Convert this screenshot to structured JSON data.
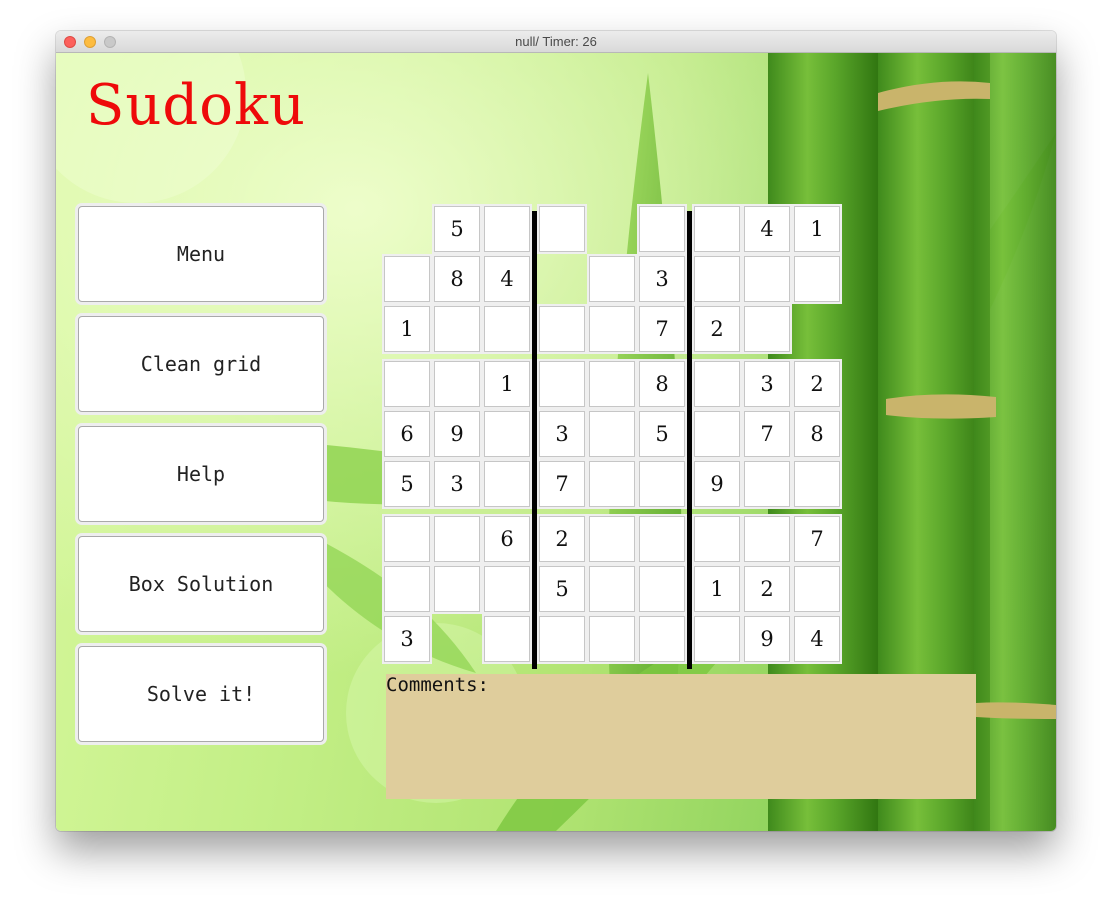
{
  "window": {
    "title": "null/ Timer: 26"
  },
  "app": {
    "title": "Sudoku"
  },
  "buttons": [
    {
      "id": "menu",
      "label": "Menu"
    },
    {
      "id": "clean-grid",
      "label": "Clean grid"
    },
    {
      "id": "help",
      "label": "Help"
    },
    {
      "id": "box-solution",
      "label": "Box Solution"
    },
    {
      "id": "solve",
      "label": "Solve it!"
    }
  ],
  "grid": {
    "rows": [
      [
        "",
        "5",
        "",
        "",
        "",
        "",
        "",
        "4",
        "1"
      ],
      [
        "",
        "8",
        "4",
        "",
        "",
        "3",
        "",
        "",
        ""
      ],
      [
        "1",
        "",
        "",
        "",
        "",
        "7",
        "2",
        "",
        ""
      ],
      [
        "",
        "",
        "1",
        "",
        "",
        "8",
        "",
        "3",
        "2"
      ],
      [
        "6",
        "9",
        "",
        "3",
        "",
        "5",
        "",
        "7",
        "8"
      ],
      [
        "5",
        "3",
        "",
        "7",
        "",
        "",
        "9",
        "",
        ""
      ],
      [
        "",
        "",
        "6",
        "2",
        "",
        "",
        "",
        "",
        "7"
      ],
      [
        "",
        "",
        "",
        "5",
        "",
        "",
        "1",
        "2",
        ""
      ],
      [
        "3",
        "",
        "",
        "",
        "",
        "",
        "",
        "9",
        "4"
      ]
    ],
    "hidden_cells": [
      [
        0,
        0
      ],
      [
        0,
        4
      ],
      [
        1,
        3
      ],
      [
        2,
        8
      ],
      [
        8,
        1
      ]
    ]
  },
  "comments": {
    "label": "Comments:",
    "value": ""
  },
  "colors": {
    "title": "#ee0a0a",
    "comments_bg": "#dfcd9c",
    "background": "#c3ef86"
  }
}
